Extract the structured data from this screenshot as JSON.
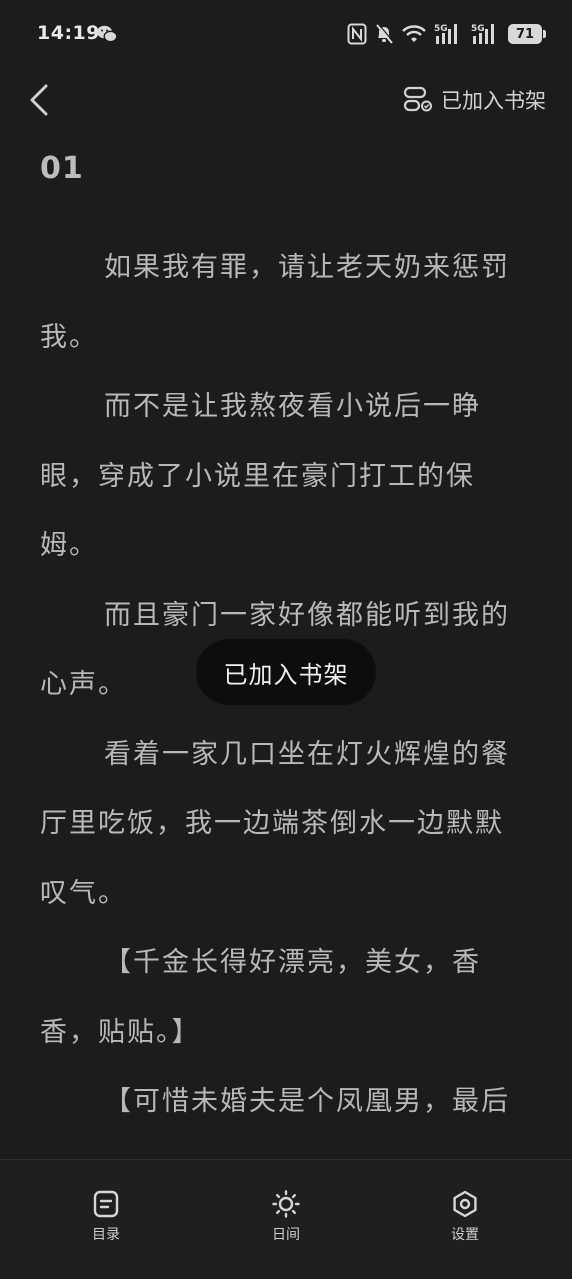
{
  "status_bar": {
    "time": "14:19",
    "battery": "71",
    "icons": [
      "wechat-icon",
      "nfc-icon",
      "mute-bell-icon",
      "wifi-icon",
      "signal-5g-icon",
      "signal-5g-icon",
      "battery-icon"
    ]
  },
  "header": {
    "back_icon": "chevron-left-icon",
    "shelf_icon": "bookshelf-icon",
    "shelf_label": "已加入书架"
  },
  "chapter": {
    "title": "01",
    "paragraphs": [
      "如果我有罪，请让老天奶来惩罚我。",
      "而不是让我熬夜看小说后一睁眼，穿成了小说里在豪门打工的保姆。",
      "而且豪门一家好像都能听到我的心声。",
      "看着一家几口坐在灯火辉煌的餐厅里吃饭，我一边端茶倒水一边默默叹气。",
      "【千金长得好漂亮，美女，香香，贴贴。】",
      "【可惜未婚夫是个凤凰男，最后"
    ]
  },
  "toast": {
    "text": "已加入书架"
  },
  "bottom_nav": {
    "items": [
      {
        "label": "目录",
        "icon": "table-of-contents-icon"
      },
      {
        "label": "日间",
        "icon": "sun-icon"
      },
      {
        "label": "设置",
        "icon": "settings-icon"
      }
    ]
  },
  "colors": {
    "background": "#1c1c1c",
    "text": "#b8b8b8",
    "toast_bg": "#0d0d0d"
  }
}
